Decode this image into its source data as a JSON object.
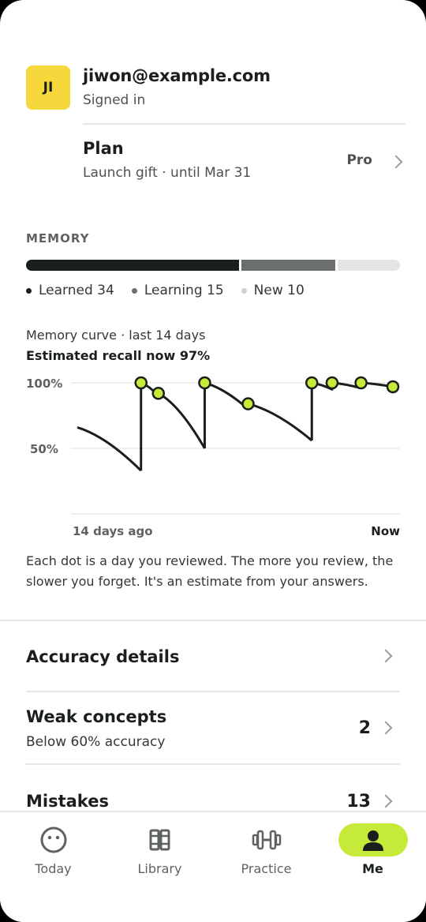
{
  "account": {
    "initials": "JI",
    "email": "jiwon@example.com",
    "status": "Signed in"
  },
  "plan": {
    "title": "Plan",
    "subtitle": "Launch gift · until Mar 31",
    "value": "Pro"
  },
  "memory": {
    "section_label": "MEMORY",
    "learned": 34,
    "learning": 15,
    "new": 10,
    "legend": {
      "learned": "Learned 34",
      "learning": "Learning 15",
      "new": "New 10"
    },
    "colors": {
      "learned": "#1a1f1c",
      "learning": "#6b706d",
      "new": "#e3e4e3"
    }
  },
  "curve": {
    "title": "Memory curve · last 14 days",
    "subtitle": "Estimated recall now 97%",
    "note": "Each dot is a day you reviewed. The more you review, the slower you forget. It's an estimate from your answers."
  },
  "chart_data": {
    "type": "line",
    "x_labels": [
      "14 days ago",
      "Now"
    ],
    "y_ticks": [
      "100%",
      "50%"
    ],
    "xlim": [
      0,
      14
    ],
    "ylim": [
      0,
      100
    ],
    "segments": [
      [
        [
          0,
          66
        ],
        [
          2.2,
          33
        ]
      ],
      [
        [
          2.2,
          100
        ],
        [
          2.8,
          90
        ],
        [
          2.8,
          92
        ],
        [
          4.4,
          50
        ]
      ],
      [
        [
          4.4,
          100
        ],
        [
          5.9,
          80
        ],
        [
          5.9,
          84
        ],
        [
          8.1,
          56
        ]
      ],
      [
        [
          8.1,
          100
        ],
        [
          8.8,
          95
        ],
        [
          8.8,
          100
        ],
        [
          9.8,
          96
        ],
        [
          9.8,
          100
        ],
        [
          10.9,
          97
        ]
      ]
    ],
    "review_points": [
      [
        2.2,
        100
      ],
      [
        2.8,
        92
      ],
      [
        4.4,
        100
      ],
      [
        5.9,
        84
      ],
      [
        8.1,
        100
      ],
      [
        8.8,
        100
      ],
      [
        9.8,
        100
      ],
      [
        10.9,
        97
      ]
    ],
    "dot_color": "#c5ea3a",
    "grid": true
  },
  "rows": [
    {
      "title": "Accuracy details"
    },
    {
      "title": "Weak concepts",
      "subtitle": "Below 60% accuracy",
      "count": "2"
    },
    {
      "title": "Mistakes",
      "count": "13"
    }
  ],
  "tabs": [
    {
      "label": "Today",
      "icon": "smile-icon"
    },
    {
      "label": "Library",
      "icon": "books-icon"
    },
    {
      "label": "Practice",
      "icon": "dumbbell-icon"
    },
    {
      "label": "Me",
      "icon": "person-icon",
      "active": true
    }
  ],
  "accent_color": "#c5ea3a"
}
